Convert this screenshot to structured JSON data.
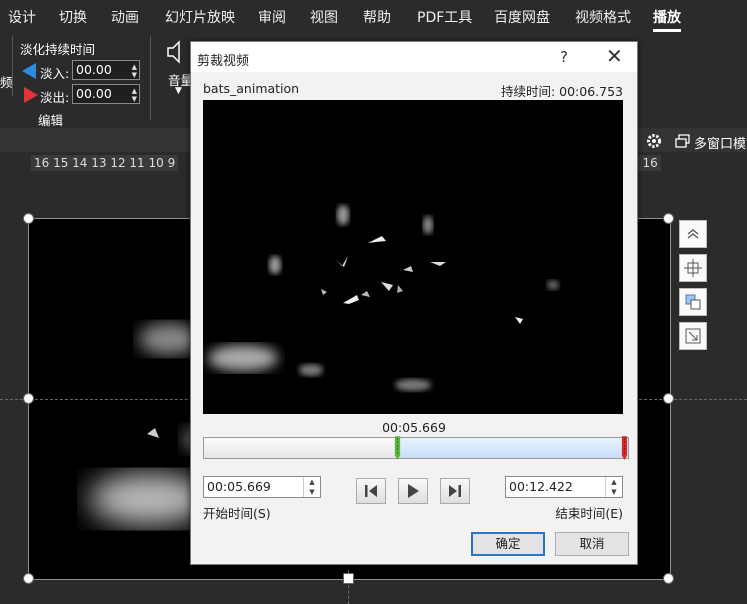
{
  "ribbon_tabs": [
    "设计",
    "切换",
    "动画",
    "幻灯片放映",
    "审阅",
    "视图",
    "帮助",
    "PDF工具",
    "百度网盘",
    "视频格式",
    "播放"
  ],
  "active_tab": "播放",
  "ribbon": {
    "left_edge_text": "频",
    "fade_group_title": "淡化持续时间",
    "fade_in_label": "淡入:",
    "fade_in_value": "00.00",
    "fade_out_label": "淡出:",
    "fade_out_value": "00.00",
    "edit_group_label": "编辑",
    "volume_label": "音量",
    "multiwindow_label": "多窗口模式"
  },
  "ruler": {
    "left_ticks": "16 15 14 13 12 11 10 9",
    "right_ticks": "5 16"
  },
  "dialog": {
    "title": "剪裁视频",
    "help": "?",
    "close": "✕",
    "file_name": "bats_animation",
    "duration_text": "持续时间: 00:06.753",
    "current_time": "00:05.669",
    "start_time_value": "00:05.669",
    "end_time_value": "00:12.422",
    "start_time_label": "开始时间(S)",
    "end_time_label": "结束时间(E)",
    "ok_label": "确定",
    "cancel_label": "取消",
    "trim_start_fraction": 0.456,
    "trim_end_fraction": 1.0
  },
  "colors": {
    "start_marker": "#5cb83a",
    "end_marker": "#d9282d",
    "fade_in_arrow": "#2f8be0",
    "fade_out_arrow": "#e0333a",
    "ok_border": "#2a73c8"
  }
}
